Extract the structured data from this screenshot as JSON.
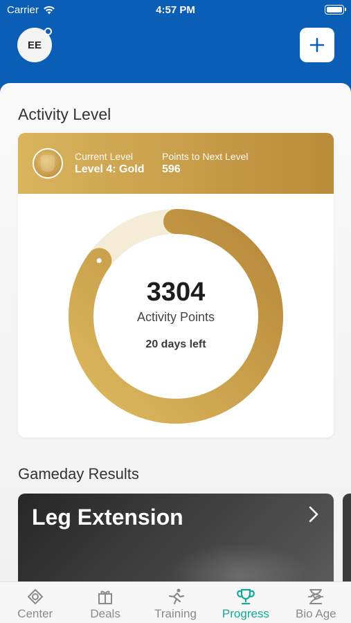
{
  "status_bar": {
    "carrier": "Carrier",
    "time": "4:57 PM"
  },
  "header": {
    "avatar_initials": "EE",
    "add_icon": "plus-icon"
  },
  "activity": {
    "section_title": "Activity Level",
    "current_level_label": "Current Level",
    "current_level_value": "Level 4: Gold",
    "next_level_label": "Points to Next Level",
    "next_level_value": "596",
    "points": "3304",
    "points_label": "Activity Points",
    "days_left": "20 days left",
    "progress_fraction": 0.85,
    "colors": {
      "gold_light": "#d9b45d",
      "gold_dark": "#b98b3a",
      "track": "#f4ecd6"
    }
  },
  "gameday": {
    "section_title": "Gameday Results",
    "card_title": "Leg Extension"
  },
  "tabs": [
    {
      "label": "Center",
      "icon": "eye-target-icon"
    },
    {
      "label": "Deals",
      "icon": "gift-icon"
    },
    {
      "label": "Training",
      "icon": "runner-icon"
    },
    {
      "label": "Progress",
      "icon": "trophy-icon",
      "active": true
    },
    {
      "label": "Bio Age",
      "icon": "bio-age-icon"
    }
  ],
  "colors": {
    "brand_blue": "#0a5eb5",
    "active_tab": "#12a89a"
  }
}
